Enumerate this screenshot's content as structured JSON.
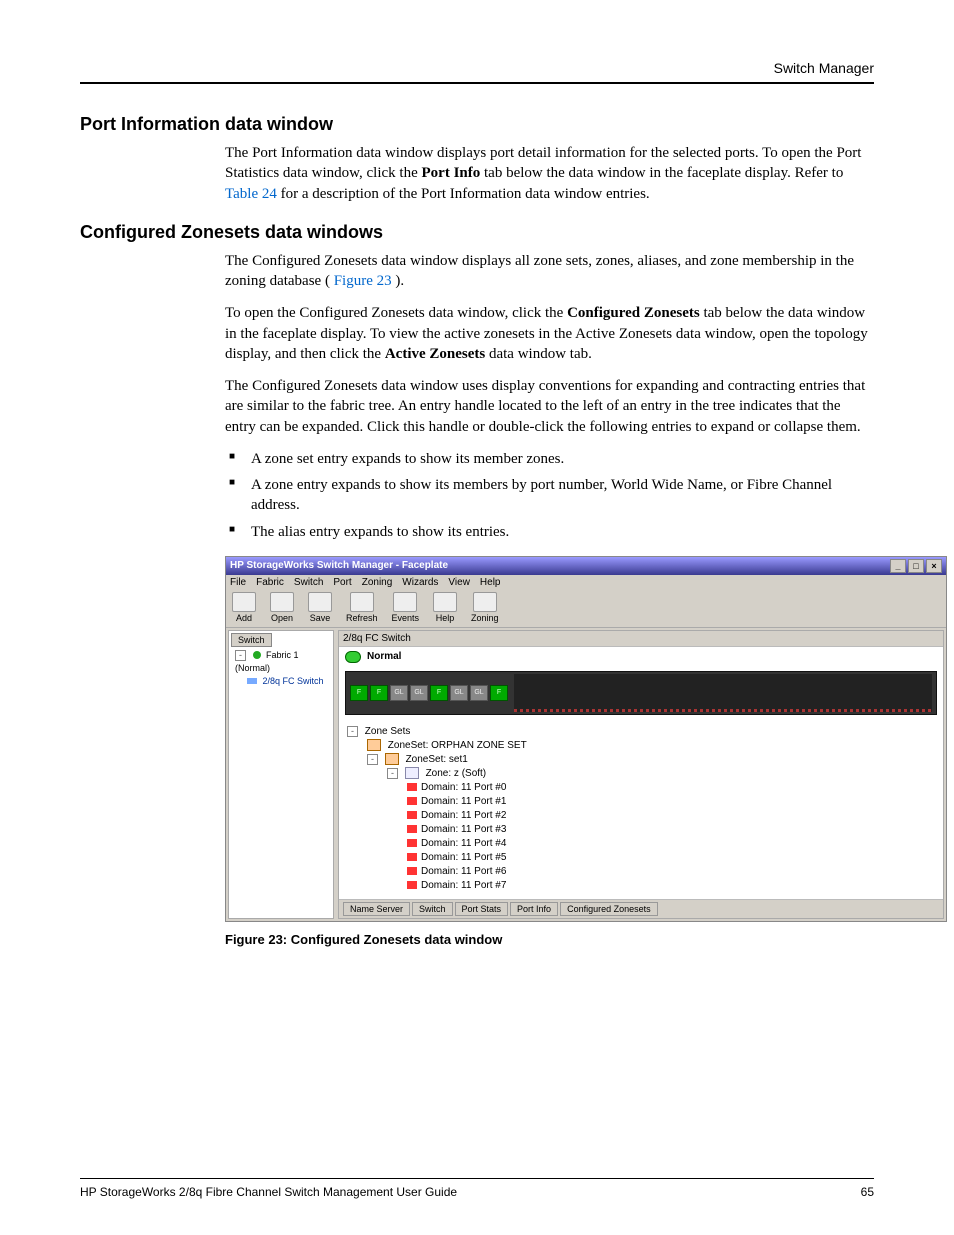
{
  "header": {
    "right_label": "Switch Manager"
  },
  "sections": {
    "port_info": {
      "title": "Port Information data window",
      "para1_a": "The Port Information data window displays port detail information for the selected ports. To open the Port Statistics data window, click the ",
      "para1_bold": "Port Info",
      "para1_b": " tab below the data window in the faceplate display. Refer to ",
      "para1_link": "Table 24",
      "para1_c": " for a description of the Port Information data window entries."
    },
    "conf_zs": {
      "title": "Configured Zonesets data windows",
      "p1_a": "The Configured Zonesets data window displays all zone sets, zones, aliases, and zone membership in the zoning database (",
      "p1_link": "Figure 23",
      "p1_b": ").",
      "p2_a": "To open the Configured Zonesets data window, click the ",
      "p2_bold1": "Configured Zonesets",
      "p2_b": " tab below the data window in the faceplate display. To view the active zonesets in the Active Zonesets data window, open the topology display, and then click the ",
      "p2_bold2": "Active Zonesets",
      "p2_c": " data window tab.",
      "p3": "The Configured Zonesets data window uses display conventions for expanding and contracting entries that are similar to the fabric tree. An entry handle located to the left of an entry in the tree indicates that the entry can be expanded. Click this handle or double-click the following entries to expand or collapse them.",
      "bullets": [
        "A zone set entry expands to show its member zones.",
        "A zone entry expands to show its members by port number, World Wide Name, or Fibre Channel address.",
        "The alias entry expands to show its entries."
      ]
    }
  },
  "app": {
    "title": "HP StorageWorks Switch Manager - Faceplate",
    "menubar": [
      "File",
      "Fabric",
      "Switch",
      "Port",
      "Zoning",
      "Wizards",
      "View",
      "Help"
    ],
    "toolbar": [
      {
        "label": "Add"
      },
      {
        "label": "Open"
      },
      {
        "label": "Save"
      },
      {
        "label": "Refresh"
      },
      {
        "label": "Events"
      },
      {
        "label": "Help"
      },
      {
        "label": "Zoning"
      }
    ],
    "left": {
      "tab": "Switch",
      "fabric": "Fabric 1 (Normal)",
      "switch": "2/8q FC Switch"
    },
    "right": {
      "header": "2/8q FC Switch",
      "status": "Normal",
      "ports": [
        "F",
        "F",
        "GL",
        "GL",
        "F",
        "GL",
        "GL",
        "F"
      ],
      "zone_root": "Zone Sets",
      "orphan": "ZoneSet: ORPHAN ZONE SET",
      "set1": "ZoneSet: set1",
      "zone": "Zone: z (Soft)",
      "members": [
        "Domain: 11 Port #0",
        "Domain: 11 Port #1",
        "Domain: 11 Port #2",
        "Domain: 11 Port #3",
        "Domain: 11 Port #4",
        "Domain: 11 Port #5",
        "Domain: 11 Port #6",
        "Domain: 11 Port #7"
      ],
      "tabs": [
        "Name Server",
        "Switch",
        "Port Stats",
        "Port Info",
        "Configured Zonesets"
      ]
    }
  },
  "figure_caption": "Figure 23:  Configured Zonesets data window",
  "footer": {
    "left": "HP StorageWorks 2/8q Fibre Channel Switch Management User Guide",
    "right": "65"
  }
}
